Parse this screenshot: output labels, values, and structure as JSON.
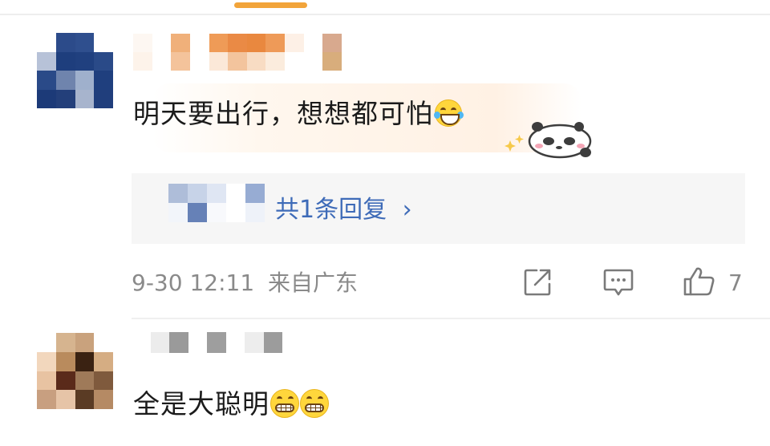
{
  "header": {
    "active_tab_color": "#f2a43a"
  },
  "comments": [
    {
      "avatar": "pixelated-avatar",
      "username": "pixelated-username",
      "text": "明天要出行，想想都可怕",
      "emoji": "laugh-cry-emoji",
      "sticker": "sleepy-panda-sticker",
      "reply_summary": "共1条回复",
      "reply_chevron": "›",
      "timestamp": "9-30 12:11",
      "location": "来自广东",
      "actions": {
        "share_icon": "share-icon",
        "comment_icon": "comment-icon",
        "like_icon": "thumbs-up-icon"
      },
      "likes": "7"
    },
    {
      "avatar": "pixelated-avatar",
      "username": "pixelated-username",
      "text": "全是大聪明",
      "emojis": [
        "grin-emoji",
        "grin-emoji"
      ]
    }
  ],
  "colors": {
    "reply_link": "#3e6bb8",
    "meta_text": "#8a8a8a",
    "reply_bg": "#f6f6f6"
  }
}
